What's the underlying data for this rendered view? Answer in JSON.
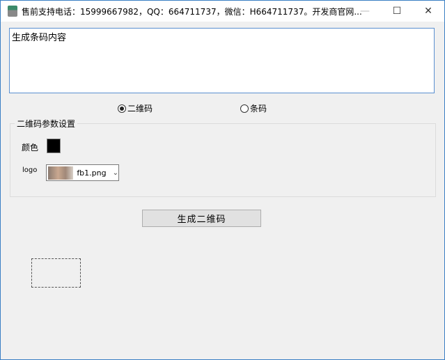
{
  "window": {
    "title": "售前支持电话：15999667982，QQ：664711737，微信：H664711737。开发商官网...",
    "minimize": "—",
    "maximize": "☐",
    "close": "✕"
  },
  "content": {
    "value": "生成条码内容"
  },
  "mode": {
    "options": [
      {
        "label": "二维码",
        "selected": true
      },
      {
        "label": "条码",
        "selected": false
      }
    ]
  },
  "qr_settings": {
    "title": "二维码参数设置",
    "color_label": "颜色",
    "color_value": "#000000",
    "logo_label": "logo",
    "logo_file": "fb1.png"
  },
  "generate_button": "生成二维码"
}
